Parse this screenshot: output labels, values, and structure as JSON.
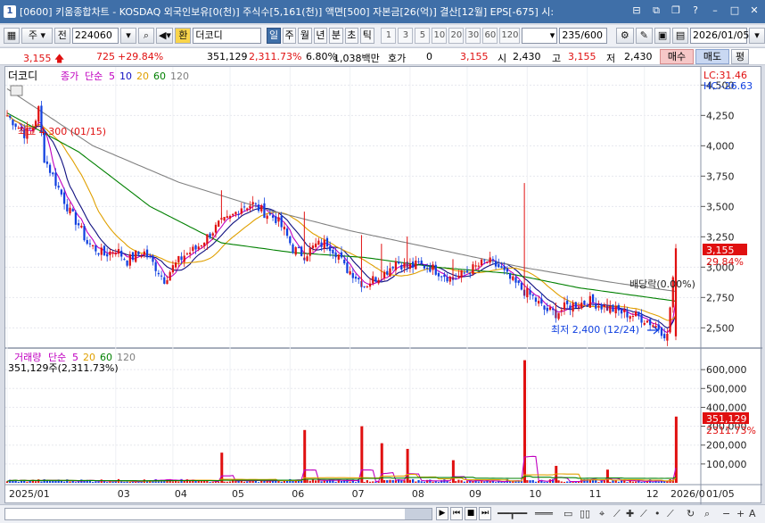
{
  "window": {
    "app_number": "1",
    "title": "[0600] 키움종합차트 - KOSDAQ 외국인보유[0(천)] 주식수[5,161(천)] 액면[500] 자본금[26(억)] 결산[12월] EPS[-675] 시:"
  },
  "toolbar": {
    "type_label": "주",
    "prev_label": "전",
    "code": "224060",
    "fav_label": "환",
    "name": "더코디",
    "periods": [
      {
        "label": "일",
        "selected": true
      },
      {
        "label": "주",
        "selected": false
      },
      {
        "label": "월",
        "selected": false
      },
      {
        "label": "년",
        "selected": false
      },
      {
        "label": "분",
        "selected": false
      },
      {
        "label": "초",
        "selected": false
      },
      {
        "label": "틱",
        "selected": false
      }
    ],
    "intervals": [
      "1",
      "3",
      "5",
      "10",
      "20",
      "30",
      "60",
      "120"
    ],
    "count": "235",
    "count_total": "/600",
    "date": "2026/01/05"
  },
  "quote": {
    "price": "3,155",
    "change": "725",
    "change_pct": "+29.84%",
    "volume": "351,129",
    "volume_ratio": "2,311.73%",
    "turnover": "6.80%",
    "amount": "1,038백만",
    "hoga_label": "호가",
    "hoga_value": "0",
    "hoga_price": "3,155",
    "open_label": "시",
    "open": "2,430",
    "high_label": "고",
    "high": "3,155",
    "low_label": "저",
    "low": "2,430",
    "buy_label": "매수",
    "sell_label": "매도",
    "eval_label": "평"
  },
  "price_panel": {
    "name_label": "더코디",
    "legend": [
      {
        "text": "종가",
        "color": "#c000c0"
      },
      {
        "text": "단순",
        "color": "#c000c0"
      },
      {
        "text": "5",
        "color": "#c000c0"
      },
      {
        "text": "10",
        "color": "#1010c0"
      },
      {
        "text": "20",
        "color": "#e0a000"
      },
      {
        "text": "60",
        "color": "#008000"
      },
      {
        "text": "120",
        "color": "#808080"
      }
    ],
    "lc_label": "LC:31.46",
    "hc_label": "HC:-26.63",
    "high_annotation": "최고 4,300 (01/15)",
    "low_annotation": "최저 2,400 (12/24)",
    "dividend_annotation": "배당락(0.00%)",
    "current_price_tag": "3,155",
    "current_change_tag": "29.84%"
  },
  "volume_panel": {
    "legend": [
      {
        "text": "거래량",
        "color": "#c000c0"
      },
      {
        "text": "단순",
        "color": "#c000c0"
      },
      {
        "text": "5",
        "color": "#c000c0"
      },
      {
        "text": "20",
        "color": "#e0a000"
      },
      {
        "text": "60",
        "color": "#008000"
      },
      {
        "text": "120",
        "color": "#808080"
      }
    ],
    "summary": "351,129주(2,311.73%)",
    "current_volume_tag": "351,129",
    "current_ratio_tag": "2311.73%"
  },
  "x_axis_labels": [
    "2025/01",
    "03",
    "04",
    "05",
    "06",
    "07",
    "08",
    "09",
    "10",
    "11",
    "12",
    "2026/0",
    "01/05"
  ],
  "colors": {
    "up": "#e01010",
    "down": "#1040e0",
    "ma5": "#c000c0",
    "ma10": "#101080",
    "ma20": "#e0a000",
    "ma60": "#008000",
    "ma120": "#808080",
    "title_bg": "#3f6fa8"
  },
  "chart_data": {
    "type": "candlestick",
    "price_axis": {
      "ticks": [
        4500,
        4250,
        4000,
        3750,
        3500,
        3250,
        3000,
        2750,
        2500
      ],
      "tick_labels": [
        "4,500",
        "4,250",
        "4,000",
        "3,750",
        "3,500",
        "3,250",
        "3,000",
        "2,750",
        "2,500"
      ],
      "ylim": [
        2370,
        4620
      ]
    },
    "volume_axis": {
      "ticks": [
        600000,
        500000,
        400000,
        300000,
        200000,
        100000
      ],
      "tick_labels": [
        "600,000",
        "500,000",
        "400,000",
        "300,000",
        "200,000",
        "100,000"
      ],
      "ylim": [
        0,
        700000
      ]
    },
    "x_range": [
      "2025/01",
      "2026/01/05"
    ],
    "price_path": [
      [
        0,
        4250
      ],
      [
        3,
        4180
      ],
      [
        6,
        4100
      ],
      [
        9,
        4150
      ],
      [
        11,
        4300
      ],
      [
        13,
        3900
      ],
      [
        16,
        3750
      ],
      [
        19,
        3600
      ],
      [
        22,
        3450
      ],
      [
        25,
        3350
      ],
      [
        28,
        3200
      ],
      [
        31,
        3150
      ],
      [
        34,
        3100
      ],
      [
        38,
        3150
      ],
      [
        42,
        3050
      ],
      [
        45,
        3100
      ],
      [
        48,
        3120
      ],
      [
        52,
        3000
      ],
      [
        55,
        2900
      ],
      [
        58,
        3000
      ],
      [
        62,
        3100
      ],
      [
        66,
        3150
      ],
      [
        70,
        3250
      ],
      [
        74,
        3350
      ],
      [
        78,
        3400
      ],
      [
        82,
        3500
      ],
      [
        86,
        3520
      ],
      [
        90,
        3450
      ],
      [
        94,
        3400
      ],
      [
        97,
        3300
      ],
      [
        100,
        3150
      ],
      [
        104,
        3100
      ],
      [
        108,
        3180
      ],
      [
        112,
        3200
      ],
      [
        116,
        3100
      ],
      [
        118,
        3000
      ],
      [
        121,
        2950
      ],
      [
        125,
        2850
      ],
      [
        128,
        2900
      ],
      [
        132,
        2950
      ],
      [
        136,
        3050
      ],
      [
        140,
        3000
      ],
      [
        144,
        3020
      ],
      [
        148,
        3000
      ],
      [
        152,
        2950
      ],
      [
        156,
        2900
      ],
      [
        160,
        2950
      ],
      [
        164,
        3000
      ],
      [
        168,
        3050
      ],
      [
        172,
        3000
      ],
      [
        176,
        2900
      ],
      [
        180,
        2820
      ],
      [
        184,
        2750
      ],
      [
        188,
        2650
      ],
      [
        192,
        2620
      ],
      [
        196,
        2680
      ],
      [
        200,
        2700
      ],
      [
        204,
        2720
      ],
      [
        208,
        2680
      ],
      [
        212,
        2650
      ],
      [
        216,
        2620
      ],
      [
        220,
        2600
      ],
      [
        224,
        2560
      ],
      [
        228,
        2500
      ],
      [
        231,
        2430
      ],
      [
        234,
        3155
      ]
    ],
    "ma120_path": [
      [
        0,
        4470
      ],
      [
        30,
        4000
      ],
      [
        60,
        3700
      ],
      [
        90,
        3480
      ],
      [
        120,
        3300
      ],
      [
        150,
        3150
      ],
      [
        180,
        3000
      ],
      [
        210,
        2880
      ],
      [
        234,
        2800
      ]
    ],
    "ma60_path": [
      [
        0,
        4270
      ],
      [
        25,
        3950
      ],
      [
        50,
        3500
      ],
      [
        75,
        3200
      ],
      [
        100,
        3120
      ],
      [
        125,
        3080
      ],
      [
        150,
        3000
      ],
      [
        175,
        2950
      ],
      [
        200,
        2830
      ],
      [
        234,
        2720
      ]
    ],
    "volume_spikes": [
      {
        "i": 75,
        "v": 160000
      },
      {
        "i": 104,
        "v": 280000
      },
      {
        "i": 124,
        "v": 300000
      },
      {
        "i": 131,
        "v": 210000
      },
      {
        "i": 140,
        "v": 180000
      },
      {
        "i": 156,
        "v": 120000
      },
      {
        "i": 181,
        "v": 650000
      },
      {
        "i": 192,
        "v": 90000
      },
      {
        "i": 210,
        "v": 70000
      },
      {
        "i": 234,
        "v": 351129
      }
    ],
    "total_bars": 235
  }
}
